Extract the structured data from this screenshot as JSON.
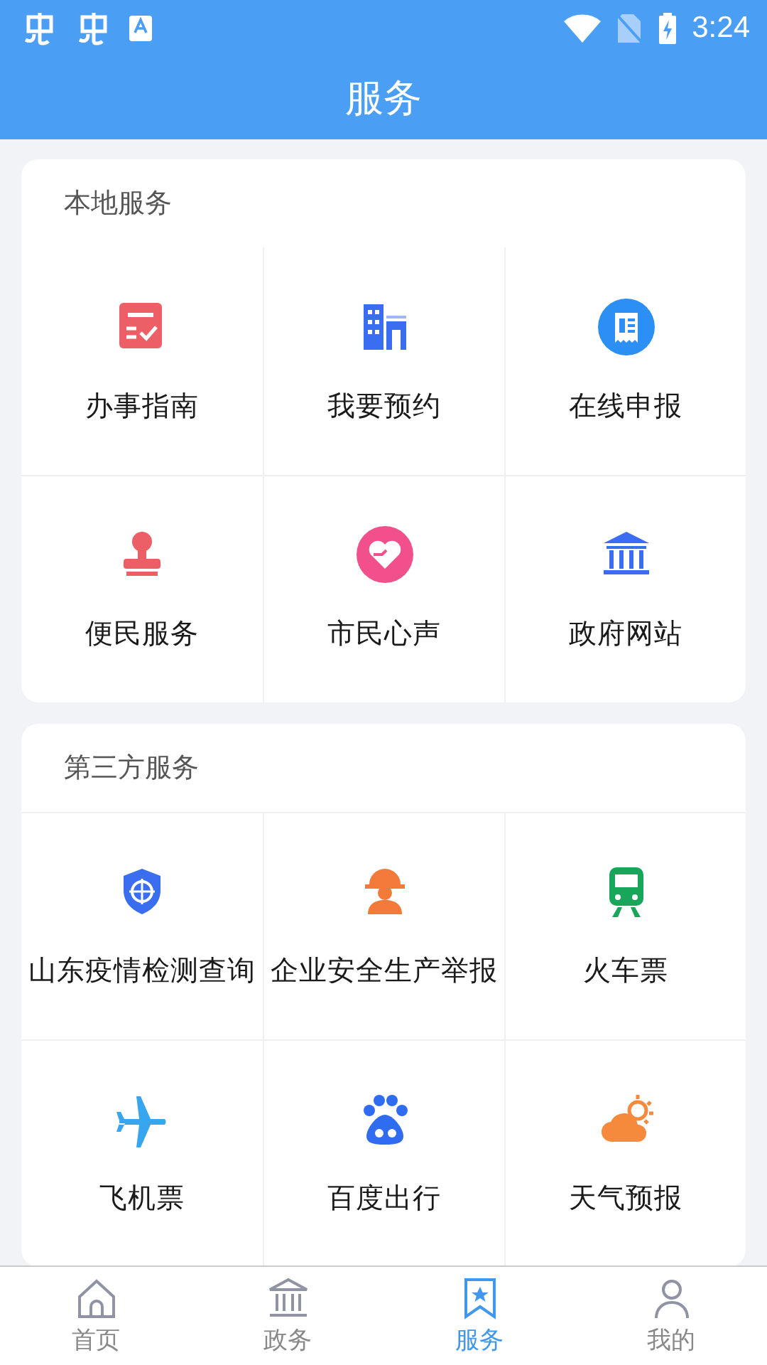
{
  "status_bar": {
    "time": "3:24"
  },
  "header": {
    "title": "服务"
  },
  "sections": [
    {
      "title": "本地服务",
      "items": [
        {
          "label": "办事指南"
        },
        {
          "label": "我要预约"
        },
        {
          "label": "在线申报"
        },
        {
          "label": "便民服务"
        },
        {
          "label": "市民心声"
        },
        {
          "label": "政府网站"
        }
      ]
    },
    {
      "title": "第三方服务",
      "items": [
        {
          "label": "山东疫情检测查询"
        },
        {
          "label": "企业安全生产举报"
        },
        {
          "label": "火车票"
        },
        {
          "label": "飞机票"
        },
        {
          "label": "百度出行"
        },
        {
          "label": "天气预报"
        }
      ]
    }
  ],
  "tabs": [
    {
      "label": "首页",
      "selected": false
    },
    {
      "label": "政务",
      "selected": false
    },
    {
      "label": "服务",
      "selected": true
    },
    {
      "label": "我的",
      "selected": false
    }
  ]
}
